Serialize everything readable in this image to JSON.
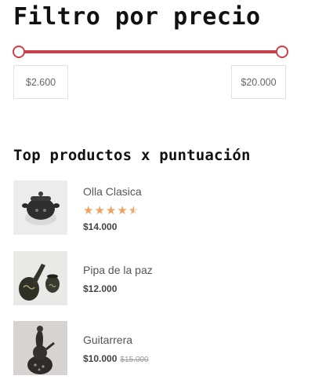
{
  "price_filter": {
    "title": "Filtro por precio",
    "min_price": "$2.600",
    "max_price": "$20.000"
  },
  "top_products": {
    "title": "Top productos x puntuación",
    "items": [
      {
        "name": "Olla Clasica",
        "rating": 4.5,
        "rating_max": 5,
        "price": "$14.000"
      },
      {
        "name": "Pipa de la paz",
        "price": "$12.000"
      },
      {
        "name": "Guitarrera",
        "price": "$10.000",
        "old_price": "$15.000"
      }
    ]
  },
  "colors": {
    "accent": "#c8404a",
    "star": "#f0a060"
  }
}
